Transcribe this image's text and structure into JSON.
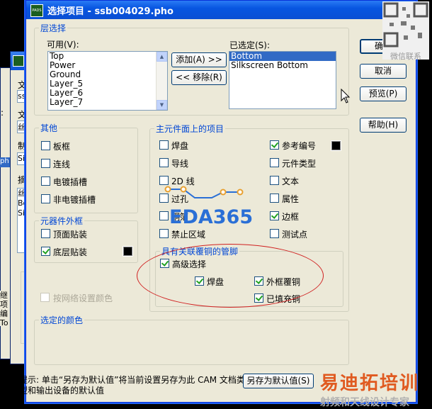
{
  "dialog": {
    "title": "选择项目 - ssb004029.pho",
    "app_icon_text": "PADS"
  },
  "background_window": {
    "labels": [
      "文",
      "ssb",
      "文",
      "丝",
      "制",
      "Sil",
      "摘",
      "丝",
      "Bo",
      "Sil",
      "目",
      "继项",
      "编",
      "To",
      ":",
      "ph"
    ]
  },
  "layer_select": {
    "group_label": "层选择",
    "available_label": "可用(V):",
    "available_items": [
      "Top",
      "Power",
      "Ground",
      "Layer_5",
      "Layer_6",
      "Layer_7"
    ],
    "add_button": "添加(A) >>",
    "remove_button": "<< 移除(R)",
    "selected_label": "已选定(S):",
    "selected_items": [
      "Bottom",
      "Silkscreen Bottom"
    ],
    "selected_index": 0
  },
  "buttons": {
    "ok": "确定",
    "cancel": "取消",
    "preview": "预览(P)",
    "help": "帮助(H)",
    "save_default": "另存为默认值(S)"
  },
  "other": {
    "group_label": "其他",
    "items": [
      {
        "label": "板框",
        "checked": false
      },
      {
        "label": "连线",
        "checked": false
      },
      {
        "label": "电镀插槽",
        "checked": false
      },
      {
        "label": "非电镀插槽",
        "checked": false
      }
    ]
  },
  "component_outline": {
    "group_label": "元器件外框",
    "items": [
      {
        "label": "顶面贴装",
        "checked": false
      },
      {
        "label": "底层贴装",
        "checked": true
      }
    ],
    "color_by_net_label": "按网络设置颜色"
  },
  "main_items": {
    "group_label": "主元件面上的项目",
    "left": [
      {
        "label": "焊盘",
        "checked": false
      },
      {
        "label": "导线",
        "checked": false
      },
      {
        "label": "2D 线",
        "checked": false
      },
      {
        "label": "过孔",
        "checked": false
      },
      {
        "label": "铜箔",
        "checked": false
      },
      {
        "label": "禁止区域",
        "checked": false
      }
    ],
    "right": [
      {
        "label": "参考编号",
        "checked": true
      },
      {
        "label": "元件类型",
        "checked": false
      },
      {
        "label": "文本",
        "checked": false
      },
      {
        "label": "属性",
        "checked": false
      },
      {
        "label": "边框",
        "checked": true
      },
      {
        "label": "测试点",
        "checked": false
      }
    ]
  },
  "copper_pins": {
    "group_label": "具有关联覆铜的管脚",
    "advanced": {
      "label": "高级选择",
      "checked": true
    },
    "pad": {
      "label": "焊盘",
      "checked": true
    },
    "outline_copper": {
      "label": "外框覆铜",
      "checked": true
    },
    "filled_copper": {
      "label": "已填充铜",
      "checked": true
    }
  },
  "selected_colors": {
    "group_label": "选定的颜色"
  },
  "hint": {
    "line1": "提示: 单击“另存为默认值”将当前设置另存为此 CAM 文档类",
    "line2": "型和输出设备的默认值"
  },
  "watermarks": {
    "center_logo": "EDA365",
    "qr_caption": "微信联系",
    "bottom_right_line1": "易迪拓培训",
    "bottom_right_line2": "射频和天线设计专家"
  },
  "colors": {
    "group_label": "#0046d5",
    "selection": "#316ac5",
    "annotation_oval": "#d02020",
    "logo_blue": "#2a6fd6",
    "logo_orange": "#e8a030"
  }
}
